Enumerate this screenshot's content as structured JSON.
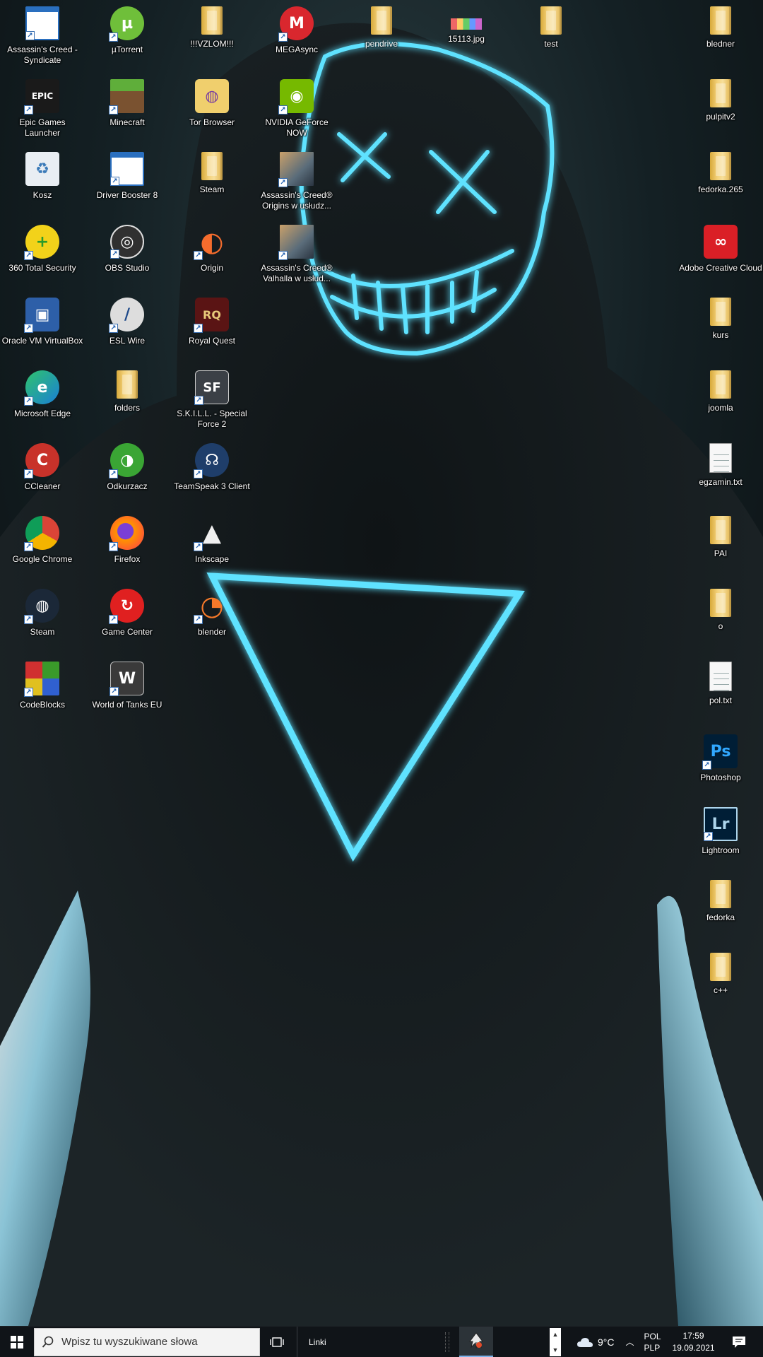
{
  "desktop": {
    "icons": [
      {
        "id": "assassins-creed-syndicate",
        "label": "Assassin's Creed - Syndicate",
        "icon": "app-window-icon",
        "shortcut": true
      },
      {
        "id": "utorrent",
        "label": "µTorrent",
        "icon": "utorrent-icon",
        "shortcut": true
      },
      {
        "id": "vzlom",
        "label": "!!!VZLOM!!!",
        "icon": "folder-icon",
        "shortcut": false
      },
      {
        "id": "megasync",
        "label": "MEGAsync",
        "icon": "mega-icon",
        "shortcut": true
      },
      {
        "id": "pendrive",
        "label": "pendrive",
        "icon": "folder-icon",
        "shortcut": false
      },
      {
        "id": "jpg-15113",
        "label": "15113.jpg",
        "icon": "image-file-icon",
        "shortcut": false
      },
      {
        "id": "test",
        "label": "test",
        "icon": "folder-icon",
        "shortcut": false
      },
      {
        "id": "bledner",
        "label": "bledner",
        "icon": "folder-icon",
        "shortcut": false
      },
      {
        "id": "epic-games",
        "label": "Epic Games Launcher",
        "icon": "epic-games-icon",
        "shortcut": true
      },
      {
        "id": "minecraft",
        "label": "Minecraft",
        "icon": "minecraft-icon",
        "shortcut": true
      },
      {
        "id": "tor-browser",
        "label": "Tor Browser",
        "icon": "tor-folder-icon",
        "shortcut": false
      },
      {
        "id": "nvidia-geforce-now",
        "label": "NVIDIA GeForce NOW",
        "icon": "nvidia-icon",
        "shortcut": true
      },
      {
        "id": "pulpitv2",
        "label": "pulpitv2",
        "icon": "folder-icon",
        "shortcut": false
      },
      {
        "id": "kosz",
        "label": "Kosz",
        "icon": "recycle-bin-icon",
        "shortcut": false
      },
      {
        "id": "driver-booster",
        "label": "Driver Booster 8",
        "icon": "app-window-icon",
        "shortcut": true
      },
      {
        "id": "steam-folder",
        "label": "Steam",
        "icon": "folder-icon",
        "shortcut": false
      },
      {
        "id": "ac-origins",
        "label": "Assassin's Creed® Origins w usłudz...",
        "icon": "game-cover-icon",
        "shortcut": true
      },
      {
        "id": "fedorka-265",
        "label": "fedorka.265",
        "icon": "folder-icon",
        "shortcut": false
      },
      {
        "id": "360-total-security",
        "label": "360 Total Security",
        "icon": "security-plus-icon",
        "shortcut": true
      },
      {
        "id": "obs-studio",
        "label": "OBS Studio",
        "icon": "obs-icon",
        "shortcut": true
      },
      {
        "id": "origin",
        "label": "Origin",
        "icon": "origin-icon",
        "shortcut": true
      },
      {
        "id": "ac-valhalla",
        "label": "Assassin's Creed® Valhalla w usłud...",
        "icon": "game-cover-icon",
        "shortcut": true
      },
      {
        "id": "adobe-cc",
        "label": "Adobe Creative Cloud",
        "icon": "adobe-cc-icon",
        "shortcut": false
      },
      {
        "id": "virtualbox",
        "label": "Oracle VM VirtualBox",
        "icon": "virtualbox-icon",
        "shortcut": true
      },
      {
        "id": "esl-wire",
        "label": "ESL Wire",
        "icon": "esl-icon",
        "shortcut": true
      },
      {
        "id": "royal-quest",
        "label": "Royal Quest",
        "icon": "royal-quest-icon",
        "shortcut": true
      },
      {
        "id": "kurs",
        "label": "kurs",
        "icon": "folder-icon",
        "shortcut": false
      },
      {
        "id": "edge",
        "label": "Microsoft Edge",
        "icon": "edge-icon",
        "shortcut": true
      },
      {
        "id": "folders",
        "label": "folders",
        "icon": "folder-icon",
        "shortcut": false
      },
      {
        "id": "skill-sf2",
        "label": "S.K.I.L.L. - Special Force 2",
        "icon": "sf2-icon",
        "shortcut": true
      },
      {
        "id": "joomla",
        "label": "joomla",
        "icon": "folder-icon",
        "shortcut": false
      },
      {
        "id": "ccleaner",
        "label": "CCleaner",
        "icon": "ccleaner-icon",
        "shortcut": true
      },
      {
        "id": "odkurzacz",
        "label": "Odkurzacz",
        "icon": "odkurzacz-icon",
        "shortcut": true
      },
      {
        "id": "teamspeak",
        "label": "TeamSpeak 3 Client",
        "icon": "teamspeak-icon",
        "shortcut": true
      },
      {
        "id": "egzamin",
        "label": "egzamin.txt",
        "icon": "text-file-icon",
        "shortcut": false
      },
      {
        "id": "chrome",
        "label": "Google Chrome",
        "icon": "chrome-icon",
        "shortcut": true
      },
      {
        "id": "firefox",
        "label": "Firefox",
        "icon": "firefox-icon",
        "shortcut": true
      },
      {
        "id": "inkscape",
        "label": "Inkscape",
        "icon": "inkscape-icon",
        "shortcut": true
      },
      {
        "id": "pai",
        "label": "PAI",
        "icon": "folder-icon",
        "shortcut": false
      },
      {
        "id": "steam",
        "label": "Steam",
        "icon": "steam-icon",
        "shortcut": true
      },
      {
        "id": "game-center",
        "label": "Game Center",
        "icon": "game-center-icon",
        "shortcut": true
      },
      {
        "id": "blender",
        "label": "blender",
        "icon": "blender-icon",
        "shortcut": true
      },
      {
        "id": "o",
        "label": "o",
        "icon": "folder-icon",
        "shortcut": false
      },
      {
        "id": "codeblocks",
        "label": "CodeBlocks",
        "icon": "codeblocks-icon",
        "shortcut": true
      },
      {
        "id": "world-of-tanks",
        "label": "World of Tanks EU",
        "icon": "wot-icon",
        "shortcut": true
      },
      {
        "id": "pol-txt",
        "label": "pol.txt",
        "icon": "text-file-icon",
        "shortcut": false
      },
      {
        "id": "photoshop",
        "label": "Photoshop",
        "icon": "photoshop-icon",
        "shortcut": true
      },
      {
        "id": "lightroom",
        "label": "Lightroom",
        "icon": "lightroom-icon",
        "shortcut": true
      },
      {
        "id": "fedorka",
        "label": "fedorka",
        "icon": "folder-icon",
        "shortcut": false
      },
      {
        "id": "cpp",
        "label": "c++",
        "icon": "folder-icon",
        "shortcut": false
      }
    ]
  },
  "taskbar": {
    "search_placeholder": "Wpisz tu wyszukiwane słowa",
    "links_label": "Linki",
    "weather_temp": "9°C",
    "lang_line1": "POL",
    "lang_line2": "PLP",
    "time": "17:59",
    "date": "19.09.2021",
    "start_icon": "windows-logo-icon",
    "search_icon": "search-icon",
    "taskview_icon": "task-view-icon",
    "weather_icon": "cloud-icon",
    "notif_icon": "notification-icon"
  },
  "colors": {
    "neon": "#5fe2ff",
    "folder": "#f2cf6e",
    "taskbar": "#101418"
  }
}
